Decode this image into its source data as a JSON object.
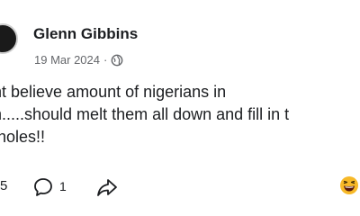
{
  "post": {
    "author": {
      "name": "Glenn Gibbins",
      "avatar_icon": "profile-avatar"
    },
    "date": "19 Mar 2024",
    "separator": "·",
    "audience_icon": "globe-icon",
    "text_lines": [
      "nt believe amount of nigerians in",
      "n.....should melt them all down and fill in t",
      " holes!!"
    ],
    "reaction_count": "5",
    "comment_count": "1",
    "reaction_emoji_icon": "laughing-face-icon",
    "colors": {
      "text": "#1c1e21",
      "secondary": "#65676b"
    }
  }
}
